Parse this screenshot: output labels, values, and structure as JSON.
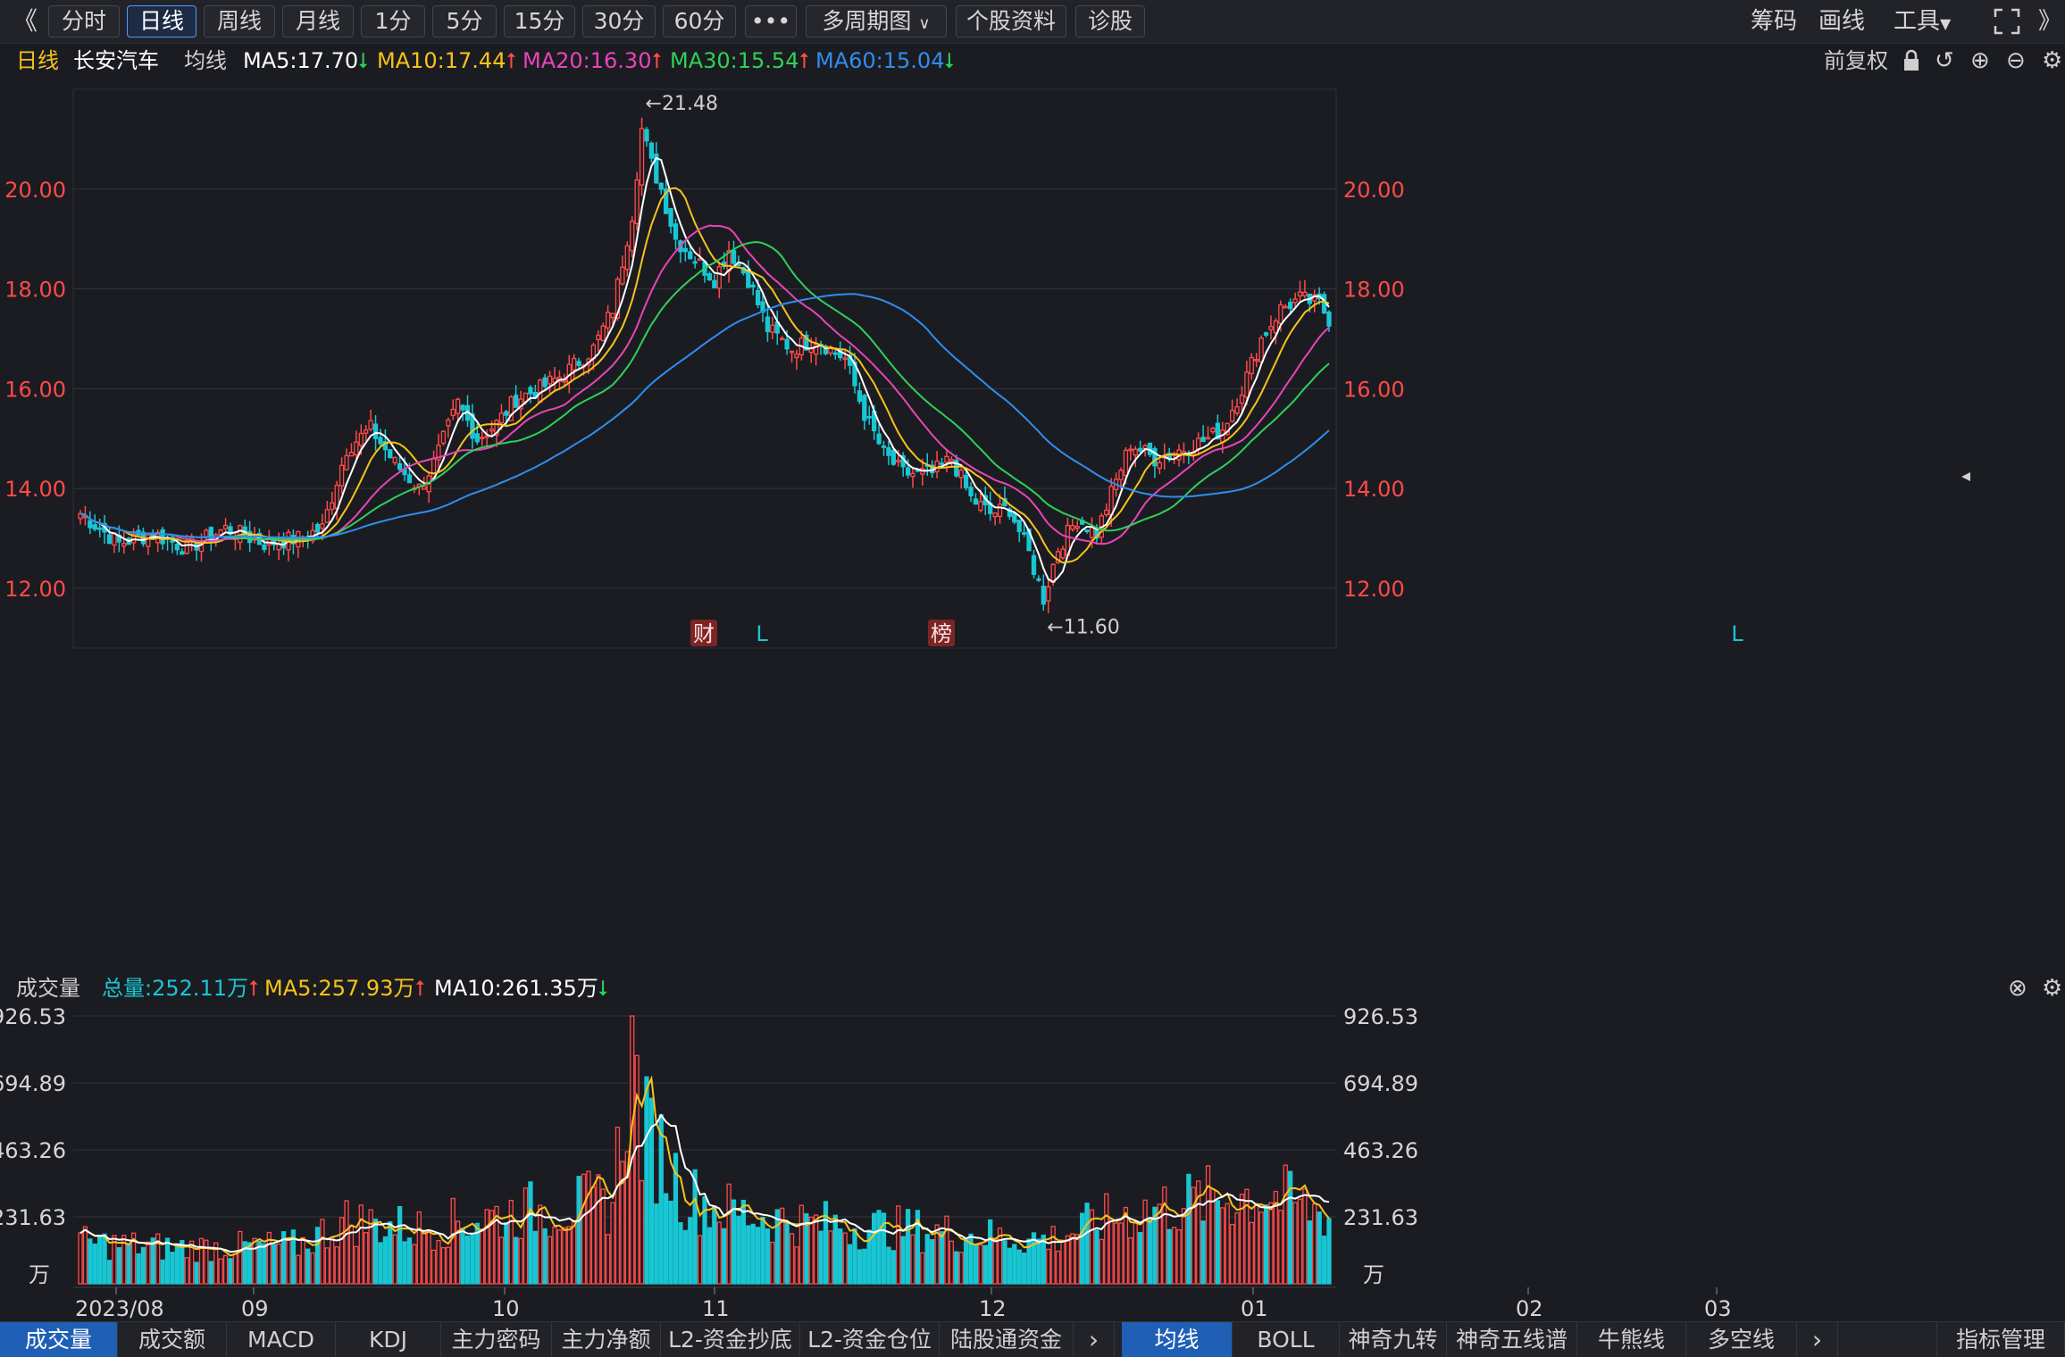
{
  "toolbar": {
    "back_icon": "double-chevron-left-icon",
    "periods": [
      "分时",
      "日线",
      "周线",
      "月线",
      "1分",
      "5分",
      "15分",
      "30分",
      "60分"
    ],
    "active_period": "日线",
    "more_label": "•••",
    "multi_period": "多周期图",
    "stock_info": "个股资料",
    "diagnose": "诊股",
    "chips": "筹码",
    "draw": "画线",
    "tools": "工具",
    "collapse_label": "》"
  },
  "ma_header": {
    "period": "日线",
    "stock_name": "长安汽车",
    "indicator": "均线",
    "ma5": "MA5:17.70",
    "ma10": "MA10:17.44",
    "ma20": "MA20:16.30",
    "ma30": "MA30:15.54",
    "ma60": "MA60:15.04",
    "adjust": "前复权"
  },
  "colors": {
    "up": "#ff4a4a",
    "down": "#19c6d3",
    "ma5": "#ffffff",
    "ma10": "#f6c31b",
    "ma20": "#e845b7",
    "ma30": "#2fd05b",
    "ma60": "#2e8ef0",
    "grid": "#33353b",
    "axis_red": "#ff4a4a"
  },
  "price_axis": {
    "labels": [
      "20.00",
      "18.00",
      "16.00",
      "14.00",
      "12.00"
    ],
    "values": [
      20,
      18,
      16,
      14,
      12
    ],
    "ylim": [
      10.8,
      22.0
    ]
  },
  "annotations": {
    "high": "←21.48",
    "low": "←11.60",
    "high_value": 21.48,
    "low_value": 11.6,
    "markers": [
      "财",
      "L",
      "榜",
      "L"
    ]
  },
  "volume_header": {
    "title": "成交量",
    "total": "总量:252.11万",
    "ma5": "MA5:257.93万",
    "ma10": "MA10:261.35万"
  },
  "volume_axis": {
    "labels": [
      "926.53",
      "694.89",
      "463.26",
      "231.63",
      "万"
    ],
    "values": [
      926.53,
      694.89,
      463.26,
      231.63
    ],
    "ylim": [
      0,
      926.53
    ]
  },
  "date_axis": [
    "2023/08",
    "09",
    "10",
    "11",
    "12",
    "01",
    "02",
    "03"
  ],
  "bottom_tabs_left": [
    "成交量",
    "成交额",
    "MACD",
    "KDJ",
    "主力密码",
    "主力净额",
    "L2-资金抄底",
    "L2-资金仓位",
    "陆股通资金"
  ],
  "bottom_tabs_right": [
    "均线",
    "BOLL",
    "神奇九转",
    "神奇五线谱",
    "牛熊线",
    "多空线"
  ],
  "active_left_tab": "成交量",
  "active_right_tab": "均线",
  "indicator_manage": "指标管理",
  "chart_data": {
    "type": "candlestick",
    "title": "",
    "close_keypoints": [
      [
        0,
        13.5
      ],
      [
        8,
        12.9
      ],
      [
        15,
        13.1
      ],
      [
        22,
        12.8
      ],
      [
        30,
        13.2
      ],
      [
        38,
        12.9
      ],
      [
        45,
        13.0
      ],
      [
        50,
        13.2
      ],
      [
        55,
        14.8
      ],
      [
        60,
        15.2
      ],
      [
        65,
        14.5
      ],
      [
        70,
        14.0
      ],
      [
        73,
        14.5
      ],
      [
        78,
        15.7
      ],
      [
        82,
        15.0
      ],
      [
        86,
        15.3
      ],
      [
        90,
        15.8
      ],
      [
        95,
        16.0
      ],
      [
        100,
        16.3
      ],
      [
        106,
        16.8
      ],
      [
        110,
        17.6
      ],
      [
        114,
        19.5
      ],
      [
        116,
        21.2
      ],
      [
        118,
        20.5
      ],
      [
        120,
        20.0
      ],
      [
        123,
        19.0
      ],
      [
        127,
        18.6
      ],
      [
        131,
        18.2
      ],
      [
        134,
        18.8
      ],
      [
        138,
        18.2
      ],
      [
        142,
        17.2
      ],
      [
        147,
        16.8
      ],
      [
        152,
        17.0
      ],
      [
        158,
        16.6
      ],
      [
        162,
        15.5
      ],
      [
        166,
        14.7
      ],
      [
        170,
        14.3
      ],
      [
        176,
        14.3
      ],
      [
        180,
        14.6
      ],
      [
        184,
        13.8
      ],
      [
        188,
        13.5
      ],
      [
        192,
        13.6
      ],
      [
        196,
        12.7
      ],
      [
        199,
        11.8
      ],
      [
        202,
        12.8
      ],
      [
        206,
        13.4
      ],
      [
        210,
        13.1
      ],
      [
        213,
        13.9
      ],
      [
        217,
        14.9
      ],
      [
        222,
        14.6
      ],
      [
        228,
        14.8
      ],
      [
        233,
        15.0
      ],
      [
        236,
        15.2
      ],
      [
        240,
        16.0
      ],
      [
        244,
        17.0
      ],
      [
        248,
        17.6
      ],
      [
        252,
        17.8
      ],
      [
        256,
        17.7
      ],
      [
        258,
        17.4
      ]
    ],
    "volume_keypoints": [
      [
        0,
        150
      ],
      [
        20,
        130
      ],
      [
        45,
        140
      ],
      [
        55,
        230
      ],
      [
        70,
        200
      ],
      [
        90,
        260
      ],
      [
        110,
        300
      ],
      [
        114,
        900
      ],
      [
        116,
        560
      ],
      [
        120,
        480
      ],
      [
        125,
        320
      ],
      [
        135,
        260
      ],
      [
        150,
        220
      ],
      [
        170,
        200
      ],
      [
        190,
        170
      ],
      [
        200,
        160
      ],
      [
        215,
        250
      ],
      [
        230,
        300
      ],
      [
        245,
        330
      ],
      [
        258,
        250
      ]
    ],
    "bars": 259
  }
}
